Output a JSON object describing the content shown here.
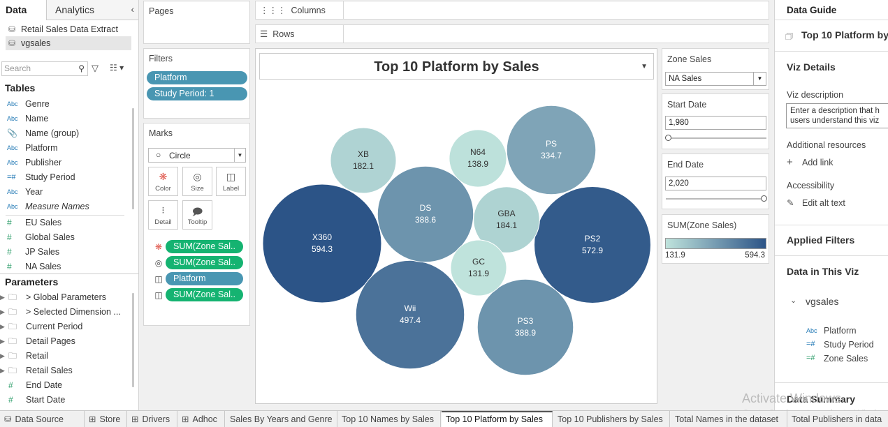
{
  "left": {
    "tabs": [
      "Data",
      "Analytics"
    ],
    "datasources": [
      "Retail Sales Data Extract",
      "vgsales"
    ],
    "search_placeholder": "Search",
    "tables_header": "Tables",
    "fields": [
      {
        "icon": "Abc",
        "label": "Genre"
      },
      {
        "icon": "Abc",
        "label": "Name"
      },
      {
        "icon": "paperclip",
        "label": "Name (group)"
      },
      {
        "icon": "Abc",
        "label": "Platform"
      },
      {
        "icon": "Abc",
        "label": "Publisher"
      },
      {
        "icon": "=#",
        "label": "Study Period"
      },
      {
        "icon": "Abc",
        "label": "Year"
      },
      {
        "icon": "Abc",
        "label": "Measure Names"
      },
      {
        "icon": "#",
        "label": "EU Sales"
      },
      {
        "icon": "#",
        "label": "Global Sales"
      },
      {
        "icon": "#",
        "label": "JP Sales"
      },
      {
        "icon": "#",
        "label": "NA Sales"
      }
    ],
    "params_header": "Parameters",
    "params": [
      {
        "icon": "folder",
        "label": "> Global Parameters"
      },
      {
        "icon": "folder",
        "label": "> Selected Dimension ..."
      },
      {
        "icon": "folder",
        "label": "Current Period"
      },
      {
        "icon": "folder",
        "label": "Detail Pages"
      },
      {
        "icon": "folder",
        "label": "Retail"
      },
      {
        "icon": "folder",
        "label": "Retail Sales"
      },
      {
        "icon": "#",
        "label": "End Date"
      },
      {
        "icon": "#",
        "label": "Start Date"
      }
    ]
  },
  "pages_title": "Pages",
  "filters": {
    "title": "Filters",
    "items": [
      "Platform",
      "Study Period: 1"
    ]
  },
  "marks": {
    "title": "Marks",
    "type": "Circle",
    "buttons": [
      "Color",
      "Size",
      "Label",
      "Detail",
      "Tooltip"
    ],
    "pills": [
      {
        "icon": "color",
        "label": "SUM(Zone Sal..",
        "color": "green"
      },
      {
        "icon": "size",
        "label": "SUM(Zone Sal..",
        "color": "green"
      },
      {
        "icon": "label",
        "label": "Platform",
        "color": "blue"
      },
      {
        "icon": "label",
        "label": "SUM(Zone Sal..",
        "color": "green"
      }
    ]
  },
  "shelves": {
    "columns": "Columns",
    "rows": "Rows"
  },
  "viz": {
    "title": "Top 10 Platform by Sales"
  },
  "chart_data": {
    "type": "packed-bubble",
    "title": "Top 10 Platform by Sales",
    "measure": "SUM(Zone Sales)",
    "color_range": [
      "#bfe3dc",
      "#2c5487"
    ],
    "points": [
      {
        "label": "X360",
        "value": 594.3
      },
      {
        "label": "PS2",
        "value": 572.9
      },
      {
        "label": "Wii",
        "value": 497.4
      },
      {
        "label": "DS",
        "value": 388.6
      },
      {
        "label": "PS3",
        "value": 388.9
      },
      {
        "label": "PS",
        "value": 334.7
      },
      {
        "label": "GBA",
        "value": 184.1
      },
      {
        "label": "XB",
        "value": 182.1
      },
      {
        "label": "N64",
        "value": 138.9
      },
      {
        "label": "GC",
        "value": 131.9
      }
    ]
  },
  "zone_sales": {
    "title": "Zone Sales",
    "value": "NA Sales"
  },
  "start_date": {
    "title": "Start Date",
    "value": "1,980",
    "level": 0
  },
  "end_date": {
    "title": "End Date",
    "value": "2,020",
    "level": 1
  },
  "legend": {
    "title": "SUM(Zone Sales)",
    "min": "131.9",
    "max": "594.3"
  },
  "guide": {
    "title": "Data Guide",
    "sheet": "Top 10 Platform by",
    "viz_details": "Viz Details",
    "viz_desc_label": "Viz description",
    "viz_desc_placeholder": "Enter a description that h users understand this viz",
    "additional": "Additional resources",
    "add_link": "Add link",
    "accessibility": "Accessibility",
    "edit_alt": "Edit alt text",
    "applied_filters": "Applied Filters",
    "data_in_viz": "Data in This Viz",
    "source": "vgsales",
    "fields": [
      {
        "icon": "Abc",
        "label": "Platform"
      },
      {
        "icon": "=#",
        "label": "Study Period"
      },
      {
        "icon": "=#",
        "label": "Zone Sales"
      }
    ],
    "data_summary": "Data Summary"
  },
  "bottom_tabs": [
    "Data Source",
    "Store",
    "Drivers",
    "Adhoc",
    "Sales By Years and Genre",
    "Top 10 Names by Sales",
    "Top 10 Platform by Sales",
    "Top 10 Publishers by Sales",
    "Total Names in the dataset",
    "Total Publishers in data"
  ],
  "watermark": {
    "line1": "Activate Windows",
    "line2": "Go to Settings to activate Windows."
  }
}
